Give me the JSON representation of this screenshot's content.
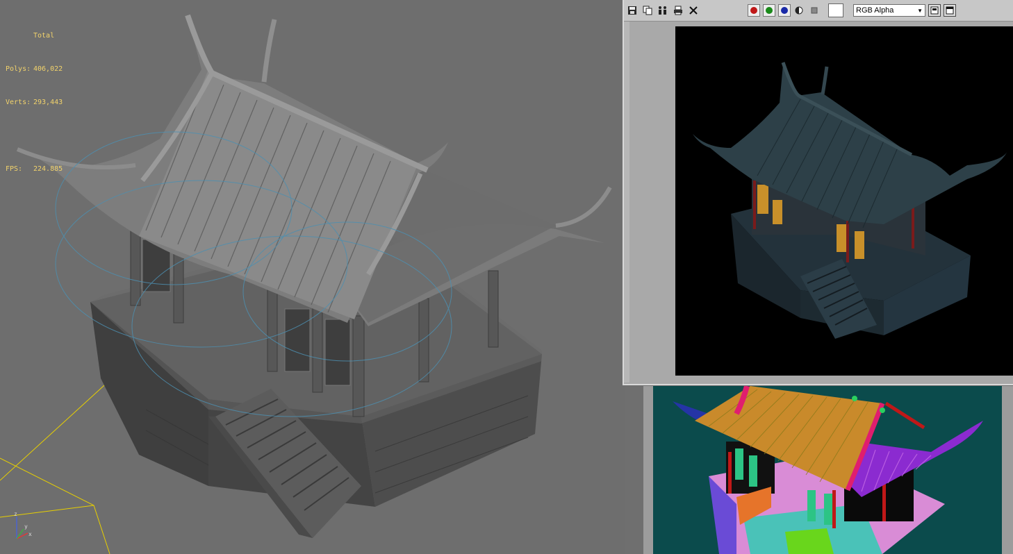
{
  "viewport": {
    "stats": {
      "header": "Total",
      "polys_label": "Polys:",
      "polys_value": "406,022",
      "verts_label": "Verts:",
      "verts_value": "293,443",
      "fps_label": "FPS:",
      "fps_value": "224.885"
    },
    "axis": {
      "x": "x",
      "y": "y",
      "z": "z"
    },
    "colors": {
      "background": "#6e6e6e",
      "stats_text": "#f2d36b",
      "camera_line": "#e8d000",
      "spline": "#4d8fb0"
    }
  },
  "render_window": {
    "toolbar": {
      "icons": [
        "save-icon",
        "copy-icon",
        "clone-icon",
        "print-icon",
        "clear-icon"
      ],
      "channels": [
        {
          "name": "red-channel-icon",
          "color": "#c01818"
        },
        {
          "name": "green-channel-icon",
          "color": "#1a8a1a"
        },
        {
          "name": "blue-channel-icon",
          "color": "#1a2aa8"
        }
      ],
      "channel_display": "RGB Alpha"
    }
  }
}
